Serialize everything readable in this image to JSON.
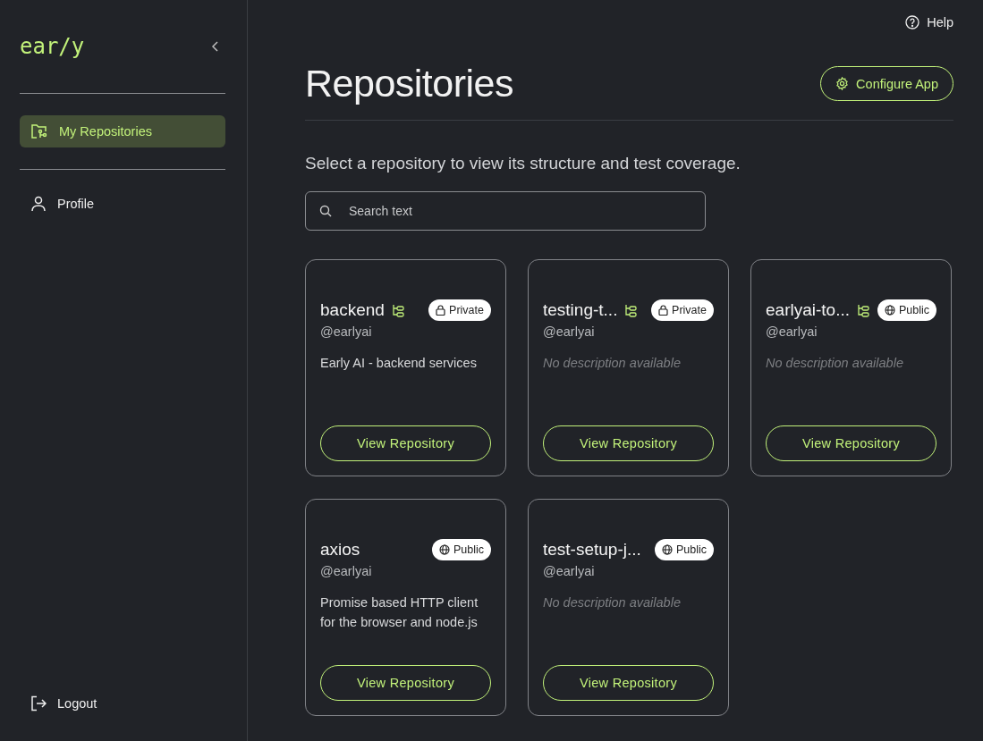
{
  "sidebar": {
    "logo": "ear/y",
    "nav": [
      {
        "label": "My Repositories",
        "selected": true
      },
      {
        "label": "Profile",
        "selected": false
      }
    ],
    "logout": "Logout"
  },
  "header": {
    "help": "Help",
    "title": "Repositories",
    "configure_button": "Configure App"
  },
  "subtitle": "Select a repository to view its structure and test coverage.",
  "search": {
    "placeholder": "Search text"
  },
  "repositories": [
    {
      "name": "backend",
      "tree_icon": true,
      "visibility": "Private",
      "kind": "private",
      "owner": "@earlyai",
      "description": {
        "kind": "text",
        "text": "Early AI - backend services"
      },
      "button": "View Repository"
    },
    {
      "name": "testing-t...",
      "tree_icon": true,
      "visibility": "Private",
      "kind": "private",
      "owner": "@earlyai",
      "description": {
        "kind": "missing",
        "text": "No description available"
      },
      "button": "View Repository"
    },
    {
      "name": "earlyai-to...",
      "tree_icon": true,
      "visibility": "Public",
      "kind": "public",
      "owner": "@earlyai",
      "description": {
        "kind": "missing",
        "text": "No description available"
      },
      "button": "View Repository"
    },
    {
      "name": "axios",
      "tree_icon": false,
      "visibility": "Public",
      "kind": "public",
      "owner": "@earlyai",
      "description": {
        "kind": "text",
        "text": "Promise based HTTP client for the browser and node.js"
      },
      "button": "View Repository"
    },
    {
      "name": "test-setup-j...",
      "tree_icon": false,
      "visibility": "Public",
      "kind": "public",
      "owner": "@earlyai",
      "description": {
        "kind": "missing",
        "text": "No description available"
      },
      "button": "View Repository"
    }
  ]
}
